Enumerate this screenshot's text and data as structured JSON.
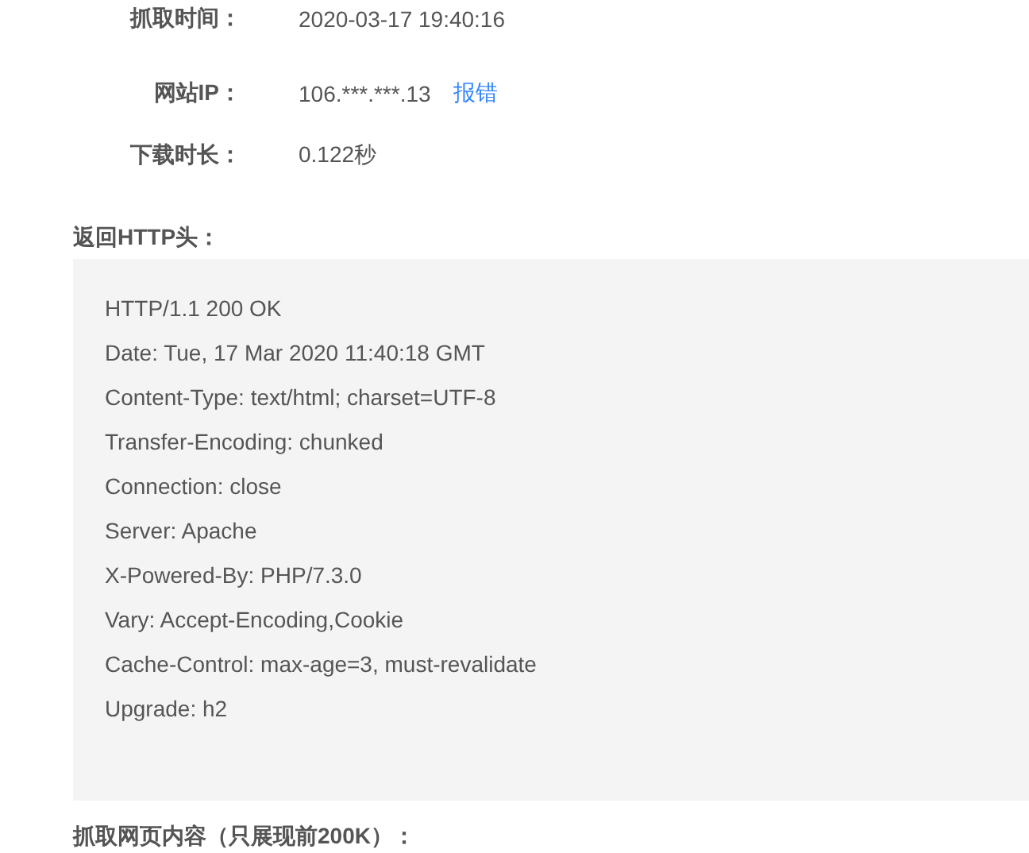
{
  "info_rows": [
    {
      "label": "抓取时间：",
      "value": "2020-03-17 19:40:16"
    },
    {
      "label": "网站IP：",
      "value": "106.***.***.13",
      "link": "报错"
    },
    {
      "label": "下载时长：",
      "value": "0.122秒"
    }
  ],
  "headers_section": {
    "heading": "返回HTTP头：",
    "lines": [
      "HTTP/1.1 200 OK",
      "Date: Tue, 17 Mar 2020 11:40:18 GMT",
      "Content-Type: text/html; charset=UTF-8",
      "Transfer-Encoding: chunked",
      "Connection: close",
      "Server: Apache",
      "X-Powered-By: PHP/7.3.0",
      "Vary: Accept-Encoding,Cookie",
      "Cache-Control: max-age=3, must-revalidate",
      "Upgrade: h2"
    ]
  },
  "content_section": {
    "heading": "抓取网页内容（只展现前200K）："
  }
}
